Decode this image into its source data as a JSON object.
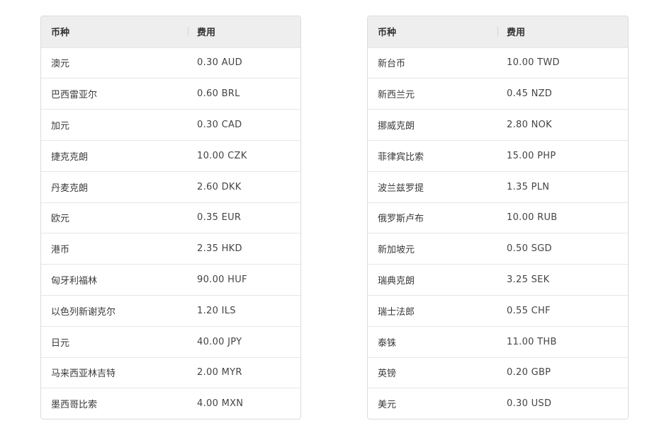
{
  "headers": {
    "currency": "币种",
    "fee": "费用"
  },
  "left_table": [
    {
      "currency": "澳元",
      "fee": "0.30 AUD"
    },
    {
      "currency": "巴西雷亚尔",
      "fee": "0.60 BRL"
    },
    {
      "currency": "加元",
      "fee": "0.30 CAD"
    },
    {
      "currency": "捷克克朗",
      "fee": "10.00 CZK"
    },
    {
      "currency": "丹麦克朗",
      "fee": "2.60 DKK"
    },
    {
      "currency": "欧元",
      "fee": "0.35 EUR"
    },
    {
      "currency": "港币",
      "fee": "2.35 HKD"
    },
    {
      "currency": "匈牙利福林",
      "fee": "90.00 HUF"
    },
    {
      "currency": "以色列新谢克尔",
      "fee": "1.20 ILS"
    },
    {
      "currency": "日元",
      "fee": "40.00 JPY"
    },
    {
      "currency": "马来西亚林吉特",
      "fee": "2.00 MYR"
    },
    {
      "currency": "墨西哥比索",
      "fee": "4.00 MXN"
    }
  ],
  "right_table": [
    {
      "currency": "新台币",
      "fee": "10.00 TWD"
    },
    {
      "currency": "新西兰元",
      "fee": "0.45 NZD"
    },
    {
      "currency": "挪威克朗",
      "fee": "2.80 NOK"
    },
    {
      "currency": "菲律宾比索",
      "fee": "15.00 PHP"
    },
    {
      "currency": "波兰兹罗提",
      "fee": "1.35 PLN"
    },
    {
      "currency": "俄罗斯卢布",
      "fee": "10.00 RUB"
    },
    {
      "currency": "新加坡元",
      "fee": "0.50 SGD"
    },
    {
      "currency": "瑞典克朗",
      "fee": "3.25 SEK"
    },
    {
      "currency": "瑞士法郎",
      "fee": "0.55 CHF"
    },
    {
      "currency": "泰铢",
      "fee": "11.00 THB"
    },
    {
      "currency": "英镑",
      "fee": "0.20 GBP"
    },
    {
      "currency": "美元",
      "fee": "0.30 USD"
    }
  ]
}
